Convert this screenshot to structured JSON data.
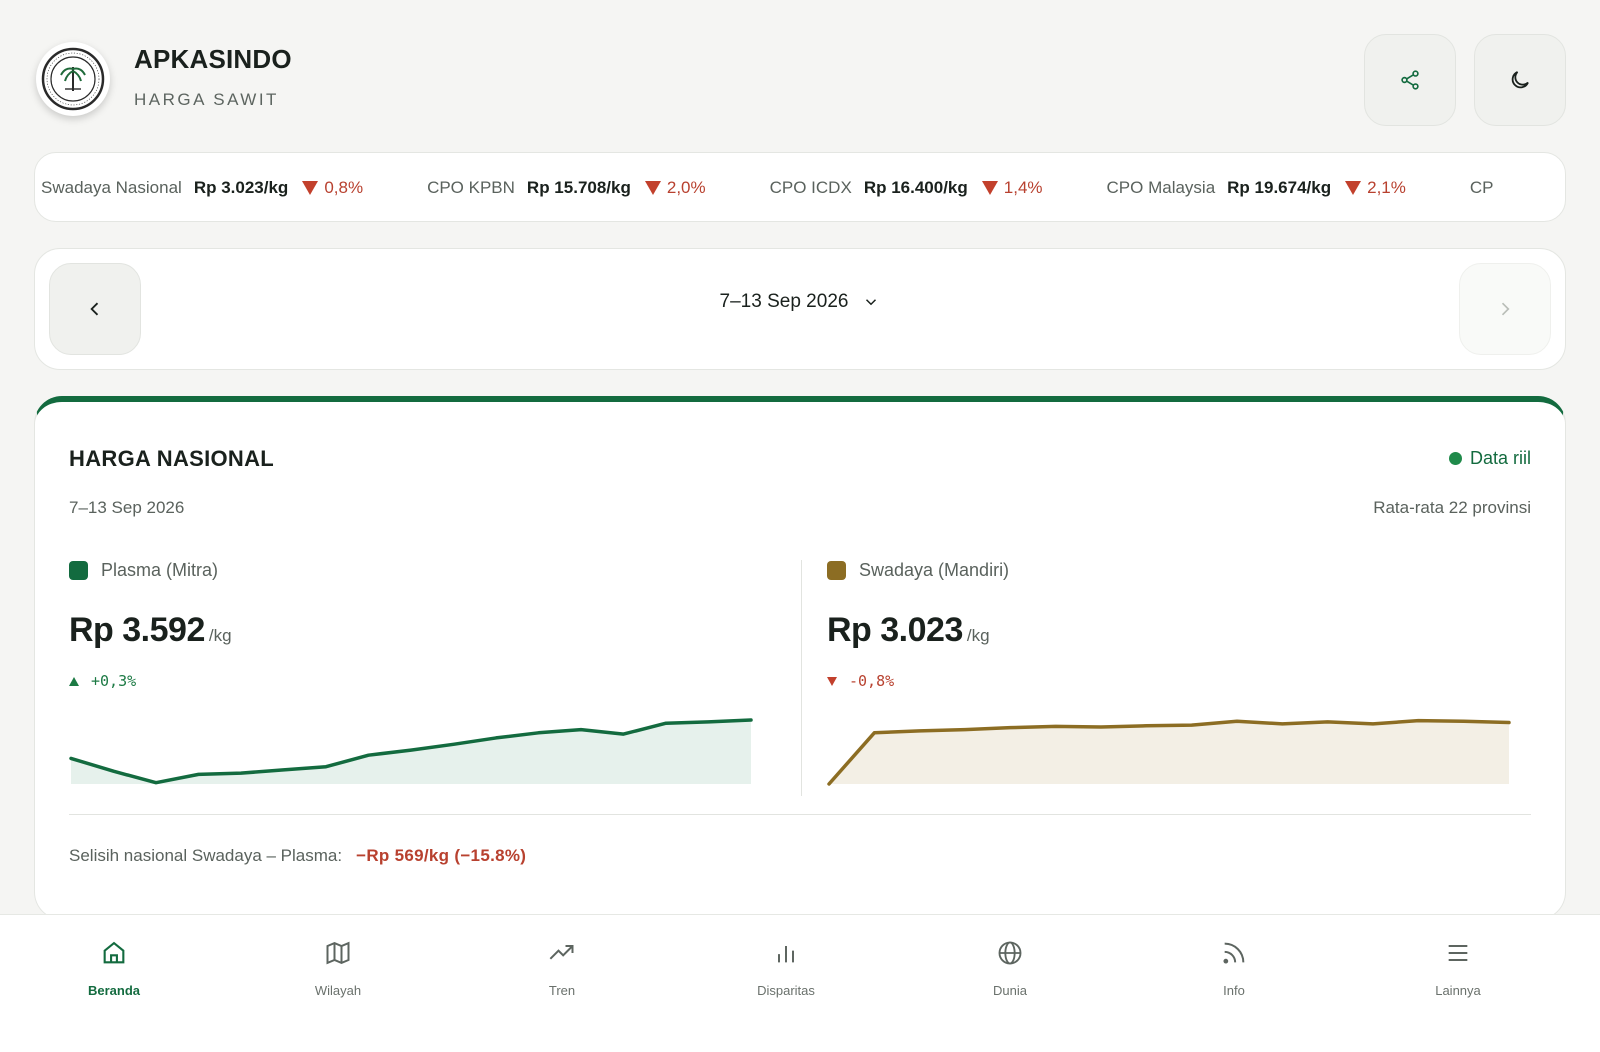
{
  "app": {
    "title": "APKASINDO",
    "subtitle": "HARGA SAWIT"
  },
  "ticker": [
    {
      "name": "Swadaya Nasional",
      "price": "Rp 3.023/kg",
      "change": "0,8%"
    },
    {
      "name": "CPO KPBN",
      "price": "Rp 15.708/kg",
      "change": "2,0%"
    },
    {
      "name": "CPO ICDX",
      "price": "Rp 16.400/kg",
      "change": "1,4%"
    },
    {
      "name": "CPO Malaysia",
      "price": "Rp 19.674/kg",
      "change": "2,1%"
    },
    {
      "name": "CP",
      "price": "",
      "change": ""
    }
  ],
  "date_nav": {
    "label": "7–13 Sep 2026"
  },
  "card": {
    "title": "HARGA NASIONAL",
    "status": "Data riil",
    "date": "7–13 Sep 2026",
    "note": "Rata-rata 22 provinsi",
    "plasma": {
      "label": "Plasma (Mitra)",
      "price": "Rp 3.592",
      "unit": "/kg",
      "change": "+0,3%",
      "color": "#136b3f"
    },
    "swadaya": {
      "label": "Swadaya (Mandiri)",
      "price": "Rp 3.023",
      "unit": "/kg",
      "change": "-0,8%",
      "color": "#8c6d23"
    },
    "diff_label": "Selisih nasional Swadaya – Plasma:",
    "diff_value": "−Rp 569/kg (−15.8%)"
  },
  "chart_data": [
    {
      "type": "area",
      "name": "Plasma (Mitra)",
      "values": [
        0.4,
        0.2,
        0.02,
        0.15,
        0.17,
        0.22,
        0.27,
        0.45,
        0.53,
        0.62,
        0.72,
        0.8,
        0.85,
        0.78,
        0.95,
        0.97,
        1.0
      ]
    },
    {
      "type": "area",
      "name": "Swadaya (Mandiri)",
      "values": [
        0.0,
        0.8,
        0.83,
        0.85,
        0.88,
        0.9,
        0.89,
        0.91,
        0.92,
        0.98,
        0.94,
        0.97,
        0.94,
        0.99,
        0.98,
        0.96
      ]
    }
  ],
  "bottom_nav": [
    {
      "label": "Beranda",
      "icon": "home-icon",
      "active": true
    },
    {
      "label": "Wilayah",
      "icon": "map-icon",
      "active": false
    },
    {
      "label": "Tren",
      "icon": "trend-icon",
      "active": false
    },
    {
      "label": "Disparitas",
      "icon": "bar-chart-icon",
      "active": false
    },
    {
      "label": "Dunia",
      "icon": "globe-icon",
      "active": false
    },
    {
      "label": "Info",
      "icon": "rss-icon",
      "active": false
    },
    {
      "label": "Lainnya",
      "icon": "menu-icon",
      "active": false
    }
  ]
}
